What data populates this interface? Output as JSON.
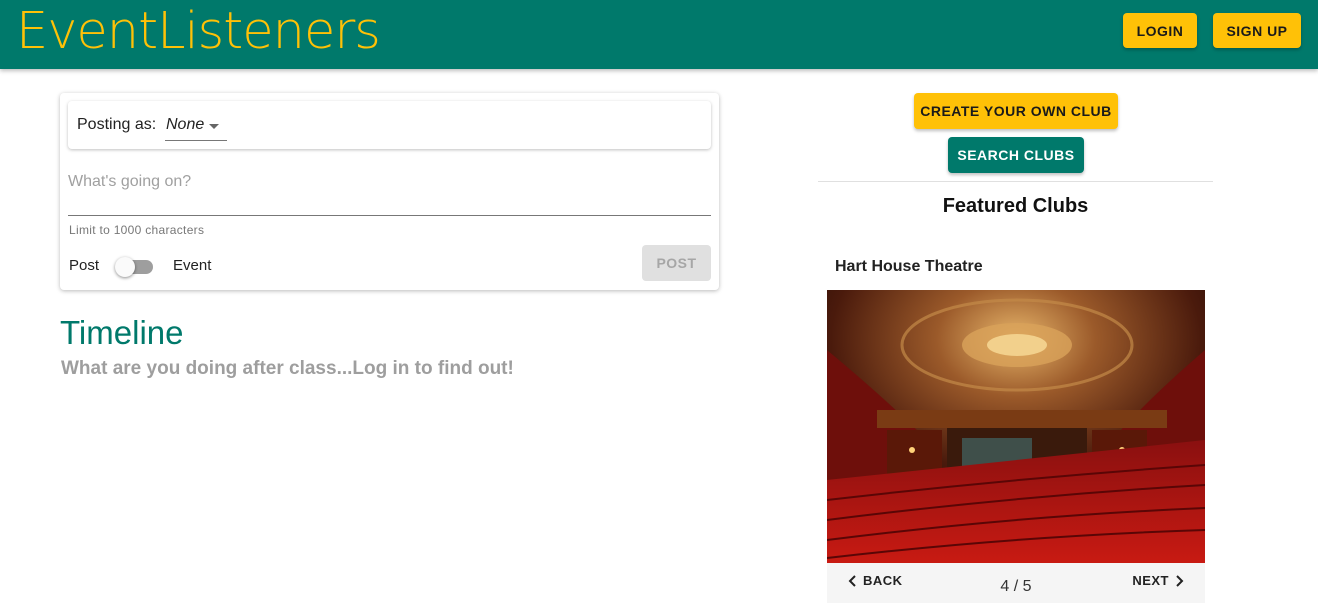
{
  "header": {
    "brand": "EventListeners",
    "login_label": "LOGIN",
    "signup_label": "SIGN UP",
    "colors": {
      "bar": "#00796b",
      "accent": "#ffc107"
    }
  },
  "composer": {
    "posting_as_label": "Posting as:",
    "posting_as_value": "None",
    "text_placeholder": "What's going on?",
    "helper_text": "Limit to 1000 characters",
    "toggle_left_label": "Post",
    "toggle_right_label": "Event",
    "toggle_on": false,
    "post_button_label": "POST"
  },
  "timeline": {
    "title": "Timeline",
    "subtitle": "What are you doing after class...Log in to find out!"
  },
  "clubs": {
    "create_button_label": "CREATE YOUR OWN CLUB",
    "search_button_label": "SEARCH CLUBS",
    "featured_heading": "Featured Clubs",
    "current_club_name": "Hart House Theatre",
    "image_icon": "theatre-interior-photo",
    "stepper": {
      "back_label": "BACK",
      "next_label": "NEXT",
      "current": 4,
      "total": 5,
      "position_text": "4 / 5"
    }
  }
}
